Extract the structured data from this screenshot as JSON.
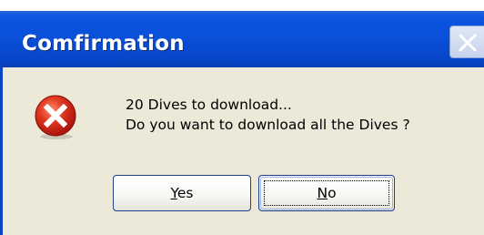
{
  "dialog": {
    "title": "Comfirmation",
    "icon": "error-icon",
    "message_line1": "20 Dives to download...",
    "message_line2": "Do you want to download all the Dives ?"
  },
  "buttons": {
    "yes_mnemonic": "Y",
    "yes_rest": "es",
    "no_mnemonic": "N",
    "no_rest": "o"
  },
  "colors": {
    "titlebar": "#0a4fd8",
    "client": "#ece9d8",
    "error_red": "#d42a18"
  }
}
